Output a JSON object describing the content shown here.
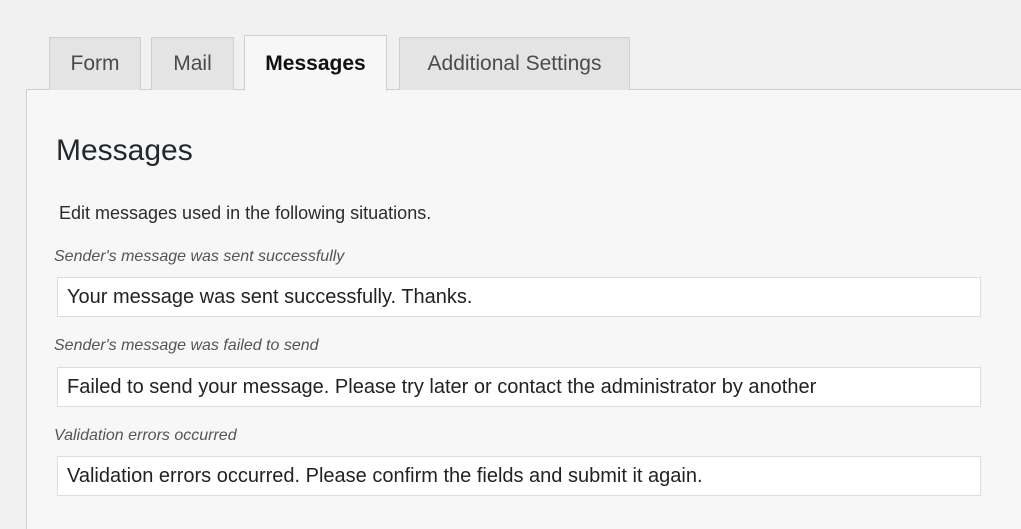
{
  "tabs": [
    {
      "label": "Form",
      "active": false
    },
    {
      "label": "Mail",
      "active": false
    },
    {
      "label": "Messages",
      "active": true
    },
    {
      "label": "Additional Settings",
      "active": false
    }
  ],
  "panel": {
    "title": "Messages",
    "intro": "Edit messages used in the following situations.",
    "fields": [
      {
        "label": "Sender's message was sent successfully",
        "value": "Your message was sent successfully. Thanks."
      },
      {
        "label": "Sender's message was failed to send",
        "value": "Failed to send your message. Please try later or contact the administrator by another"
      },
      {
        "label": "Validation errors occurred",
        "value": "Validation errors occurred. Please confirm the fields and submit it again."
      }
    ]
  }
}
